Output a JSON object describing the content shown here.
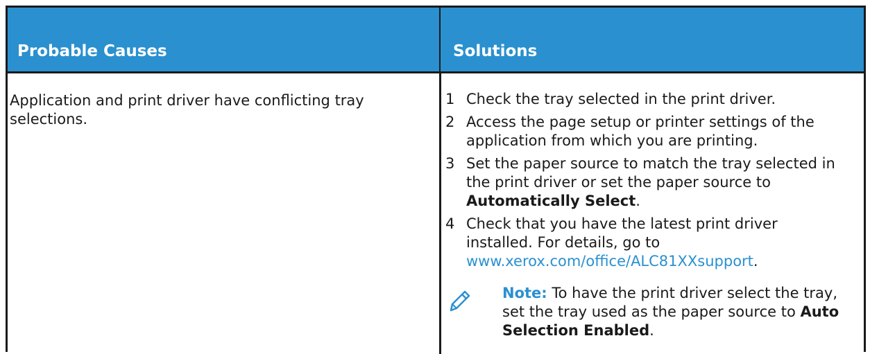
{
  "table": {
    "header": {
      "causes": "Probable Causes",
      "solutions": "Solutions"
    },
    "cause": "Application and print driver have conflicting tray selections.",
    "steps": [
      {
        "num": "1",
        "text": "Check the tray selected in the print driver."
      },
      {
        "num": "2",
        "text": "Access the page setup or printer settings of the application from which you are printing."
      },
      {
        "num": "3",
        "text_before": "Set the paper source to match the tray selected in the print driver or set the paper source to ",
        "bold": "Automatically Select",
        "text_after": "."
      },
      {
        "num": "4",
        "text_before": "Check that you have the latest print driver installed. For details, go to ",
        "link": "www.xerox.com/office/ALC81XXsupport",
        "text_after": "."
      }
    ],
    "note": {
      "icon": "pencil-icon",
      "label": "Note:",
      "text_before": " To have the print driver select the tray, set the tray used as the paper source to ",
      "bold": "Auto Selection Enabled",
      "text_after": "."
    }
  },
  "colors": {
    "header_bg": "#2a90cf",
    "link": "#2a90cf"
  }
}
